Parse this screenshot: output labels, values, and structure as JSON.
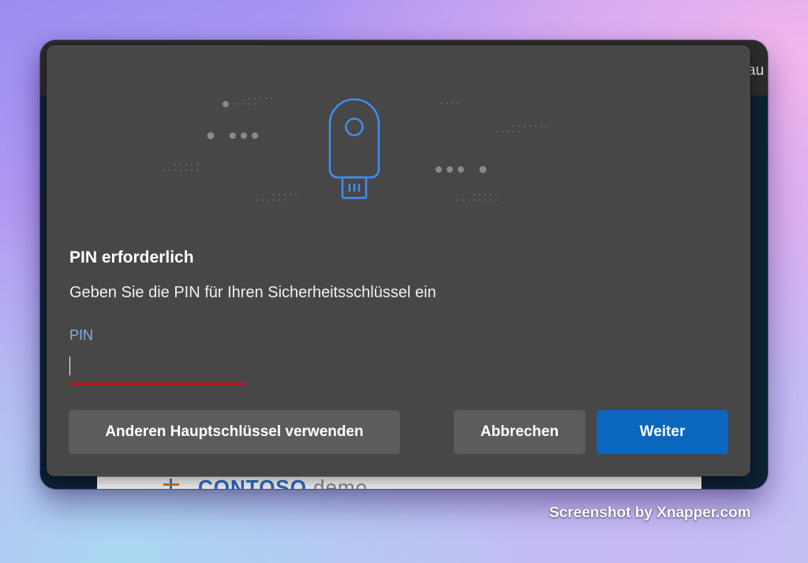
{
  "background_page": {
    "edge_text": "au",
    "logo_text": "CONTOSO",
    "logo_sub": "demo"
  },
  "dialog": {
    "illustration_icon": "usb-security-key-icon",
    "title": "PIN erforderlich",
    "description": "Geben Sie die PIN für Ihren Sicherheitsschlüssel ein",
    "pin_field": {
      "label": "PIN",
      "value": ""
    },
    "buttons": {
      "other_key": "Anderen Hauptschlüssel verwenden",
      "cancel": "Abbrechen",
      "next": "Weiter"
    }
  },
  "watermark": "Screenshot by Xnapper.com",
  "colors": {
    "dialog_bg": "#474747",
    "accent": "#0a67bd",
    "error_underline": "#d01010",
    "label_blue": "#7fb0e0",
    "key_icon_blue": "#3f8ff0"
  }
}
